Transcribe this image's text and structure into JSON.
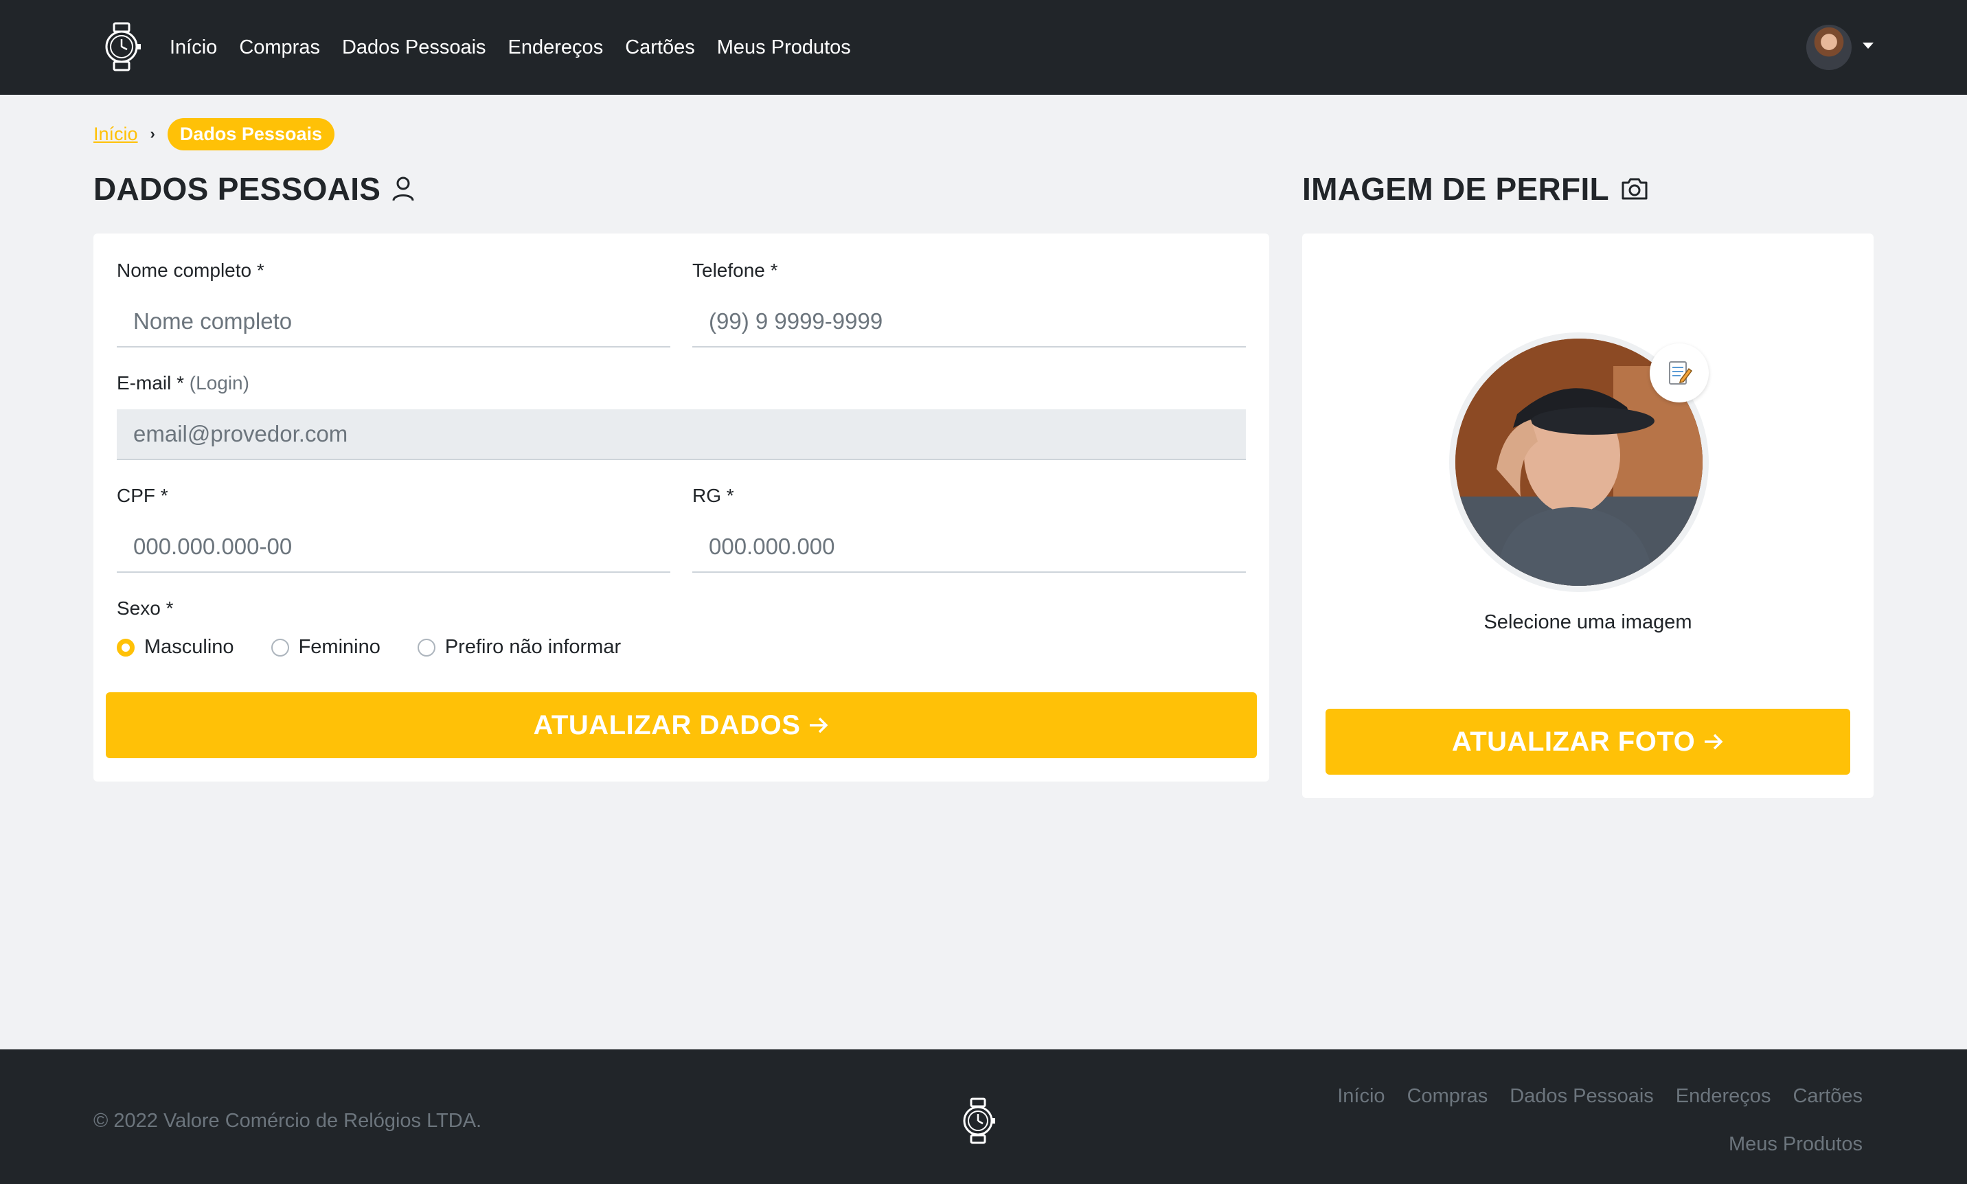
{
  "navbar": {
    "links": [
      "Início",
      "Compras",
      "Dados Pessoais",
      "Endereços",
      "Cartões",
      "Meus Produtos"
    ]
  },
  "breadcrumb": {
    "home": "Início",
    "current": "Dados Pessoais"
  },
  "personal": {
    "title": "DADOS PESSOAIS",
    "name_label": "Nome completo *",
    "name_placeholder": "Nome completo",
    "phone_label": "Telefone *",
    "phone_placeholder": "(99) 9 9999-9999",
    "email_label": "E-mail *",
    "email_hint": "(Login)",
    "email_placeholder": "email@provedor.com",
    "cpf_label": "CPF *",
    "cpf_placeholder": "000.000.000-00",
    "rg_label": "RG *",
    "rg_placeholder": "000.000.000",
    "sex_label": "Sexo *",
    "sex_options": [
      "Masculino",
      "Feminino",
      "Prefiro não informar"
    ],
    "sex_selected": "Masculino",
    "submit_label": "ATUALIZAR DADOS"
  },
  "profile": {
    "title": "IMAGEM DE PERFIL",
    "caption": "Selecione uma imagem",
    "edit_icon": "memo-icon",
    "submit_label": "ATUALIZAR FOTO"
  },
  "footer": {
    "copyright": "© 2022 Valore Comércio de Relógios LTDA.",
    "links": [
      "Início",
      "Compras",
      "Dados Pessoais",
      "Endereços",
      "Cartões",
      "Meus Produtos"
    ]
  },
  "colors": {
    "accent": "#ffc107",
    "navbar": "#212529",
    "page_bg": "#f1f2f4"
  }
}
